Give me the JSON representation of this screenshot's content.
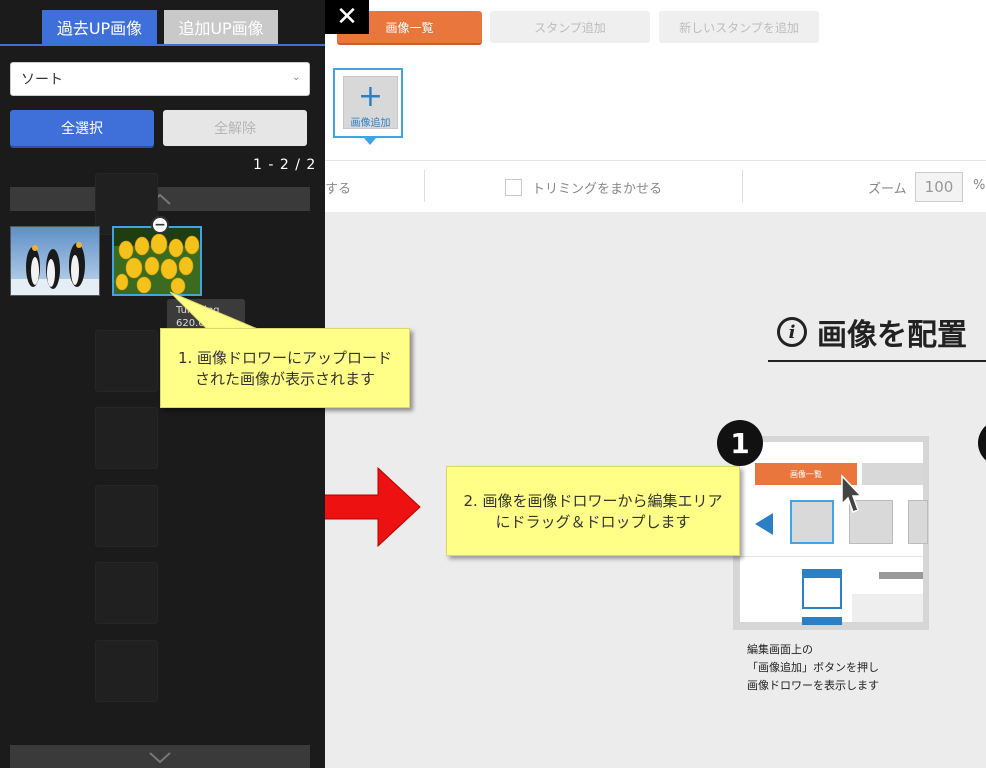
{
  "drawer": {
    "tabs": [
      {
        "label": "過去UP画像"
      },
      {
        "label": "追加UP画像"
      }
    ],
    "sort": {
      "value": "ソート"
    },
    "select_all_label": "全選択",
    "deselect_all_label": "全解除",
    "count": "1 - 2 / 2",
    "tooltip": {
      "line1": "Tulipsjpg",
      "line2": "620.68"
    },
    "thumbnails": [
      {
        "icon": "penguins-image"
      },
      {
        "icon": "tulips-image"
      }
    ]
  },
  "toolbar": {
    "tab_list_label": "画像一覧",
    "tab_stamp_label": "スタンプ追加",
    "tab_new_stamp_label": "新しいスタンプを追加",
    "add_image_label": "画像追加",
    "add_image_plus": "+"
  },
  "options": {
    "partial_text": "する",
    "trim_label": "トリミングをまかせる",
    "zoom_label": "ズーム",
    "zoom_value": "100",
    "zoom_unit": "%"
  },
  "guide": {
    "title": "画像を配置",
    "info_glyph": "i",
    "step1_number": "1",
    "step1_mini_tab": "画像一覧",
    "step1_text_lines": [
      "編集画面上の",
      "「画像追加」ボタンを押し",
      "画像ドロワーを表示します"
    ]
  },
  "callouts": {
    "drawer_line1": "1. 画像ドロワーにアップロード",
    "drawer_line2": "された画像が表示されます",
    "drag_line1": "2. 画像を画像ドロワーから編集エリア",
    "drag_line2": "にドラッグ＆ドロップします"
  },
  "close_label": "✕",
  "colors": {
    "accent_blue": "#3f6fd8",
    "accent_orange": "#e9773d",
    "callout_yellow": "#ffff88",
    "arrow_red": "#ee1111"
  }
}
